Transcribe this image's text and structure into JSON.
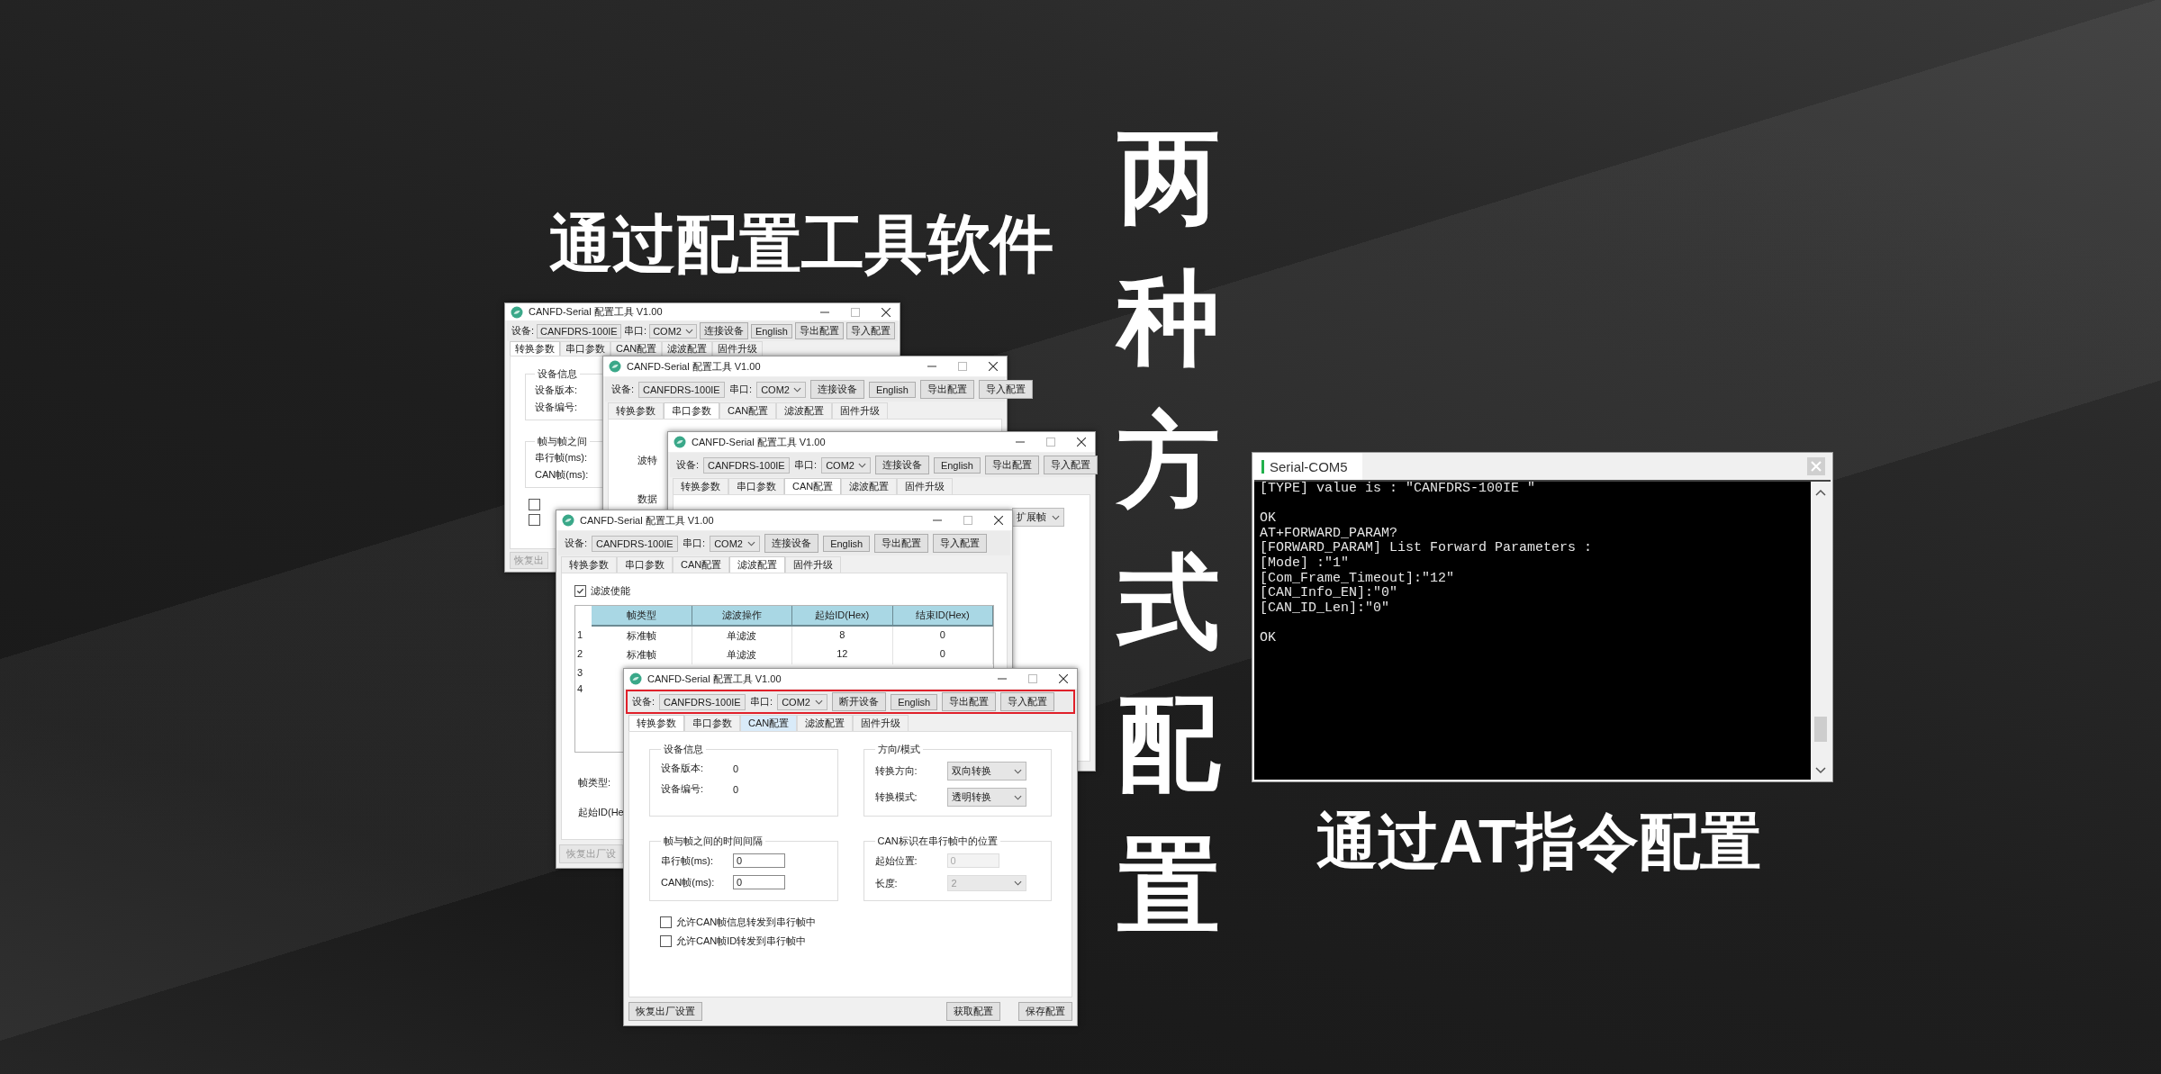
{
  "headline_left": "通过配置工具软件",
  "headline_center": "两种方式配置",
  "headline_right": "通过AT指令配置",
  "windows": [
    {
      "kind": "settings",
      "title": "CANFD-Serial 配置工具 V1.00",
      "toolbar": {
        "device_label": "设备:",
        "device": "CANFDRS-100IE",
        "port_label": "串口:",
        "port": "COM2",
        "buttons": [
          "连接设备",
          "English",
          "导出配置",
          "导入配置"
        ],
        "highlighted": false
      },
      "tabs": [
        {
          "label": "转换参数",
          "selected": true
        },
        {
          "label": "串口参数",
          "selected": false
        },
        {
          "label": "CAN配置",
          "selected": false
        },
        {
          "label": "滤波配置",
          "selected": false
        },
        {
          "label": "固件升级",
          "selected": false
        }
      ],
      "group_rows": [
        [
          {
            "title": "设备信息",
            "rows": [
              {
                "kind": "label",
                "label": "设备版本:"
              },
              {
                "kind": "label",
                "label": "设备编号:"
              }
            ]
          }
        ],
        [
          {
            "title": "帧与帧之间",
            "rows": [
              {
                "kind": "label",
                "label": "串行帧(ms):"
              },
              {
                "kind": "label",
                "label": "CAN帧(ms):"
              }
            ]
          }
        ]
      ],
      "checkboxes": [
        {
          "checked": false
        },
        {
          "checked": false
        }
      ],
      "footer_left": {
        "label": "恢复出",
        "disabled": true
      }
    },
    {
      "kind": "serial",
      "title": "CANFD-Serial 配置工具 V1.00",
      "toolbar": {
        "device_label": "设备:",
        "device": "CANFDRS-100IE",
        "port_label": "串口:",
        "port": "COM2",
        "buttons": [
          "连接设备",
          "English",
          "导出配置",
          "导入配置"
        ],
        "highlighted": false
      },
      "tabs": [
        {
          "label": "转换参数",
          "selected": false
        },
        {
          "label": "串口参数",
          "selected": true
        },
        {
          "label": "CAN配置",
          "selected": false
        },
        {
          "label": "滤波配置",
          "selected": false
        },
        {
          "label": "固件升级",
          "selected": false
        }
      ],
      "fields": [
        {
          "label": "波特"
        },
        {
          "label": "数据"
        }
      ]
    },
    {
      "kind": "can",
      "title": "CANFD-Serial 配置工具 V1.00",
      "toolbar": {
        "device_label": "设备:",
        "device": "CANFDRS-100IE",
        "port_label": "串口:",
        "port": "COM2",
        "buttons": [
          "连接设备",
          "English",
          "导出配置",
          "导入配置"
        ],
        "highlighted": false
      },
      "tabs": [
        {
          "label": "转换参数",
          "selected": false
        },
        {
          "label": "串口参数",
          "selected": false
        },
        {
          "label": "CAN配置",
          "selected": true
        },
        {
          "label": "滤波配置",
          "selected": false
        },
        {
          "label": "固件升级",
          "selected": false
        }
      ],
      "fields": [
        {
          "value": "扩展帧"
        }
      ]
    },
    {
      "kind": "filter",
      "title": "CANFD-Serial 配置工具 V1.00",
      "toolbar": {
        "device_label": "设备:",
        "device": "CANFDRS-100IE",
        "port_label": "串口:",
        "port": "COM2",
        "buttons": [
          "连接设备",
          "English",
          "导出配置",
          "导入配置"
        ],
        "highlighted": false
      },
      "tabs": [
        {
          "label": "转换参数",
          "selected": false
        },
        {
          "label": "串口参数",
          "selected": false
        },
        {
          "label": "CAN配置",
          "selected": false
        },
        {
          "label": "滤波配置",
          "selected": true
        },
        {
          "label": "固件升级",
          "selected": false
        }
      ],
      "enable": {
        "label": "滤波使能",
        "checked": true
      },
      "table": {
        "columns": [
          "帧类型",
          "滤波操作",
          "起始ID(Hex)",
          "结束ID(Hex)"
        ],
        "rows": [
          {
            "index": "1",
            "cells": [
              "标准帧",
              "单滤波",
              "8",
              "0"
            ]
          },
          {
            "index": "2",
            "cells": [
              "标准帧",
              "单滤波",
              "12",
              "0"
            ]
          },
          {
            "index": "3"
          },
          {
            "index": "4"
          }
        ]
      },
      "fields": [
        {
          "label": "帧类型:"
        },
        {
          "label": "起始ID(He"
        }
      ],
      "footer_left": {
        "label": "恢复出厂设",
        "disabled": true
      }
    },
    {
      "kind": "settings",
      "title": "CANFD-Serial 配置工具 V1.00",
      "toolbar": {
        "device_label": "设备:",
        "device": "CANFDRS-100IE",
        "port_label": "串口:",
        "port": "COM2",
        "buttons": [
          "断开设备",
          "English",
          "导出配置",
          "导入配置"
        ],
        "highlighted": true
      },
      "tabs": [
        {
          "label": "转换参数",
          "selected": true,
          "hovered": false
        },
        {
          "label": "串口参数",
          "selected": false,
          "hovered": false
        },
        {
          "label": "CAN配置",
          "selected": false,
          "hovered": true
        },
        {
          "label": "滤波配置",
          "selected": false,
          "hovered": false
        },
        {
          "label": "固件升级",
          "selected": false,
          "hovered": false
        }
      ],
      "group_rows": [
        [
          {
            "title": "设备信息",
            "rows": [
              {
                "kind": "text",
                "label": "设备版本:",
                "value": "0"
              },
              {
                "kind": "text",
                "label": "设备编号:",
                "value": "0"
              }
            ]
          },
          {
            "title": "方向/模式",
            "rows": [
              {
                "kind": "select",
                "label": "转换方向:",
                "value": "双向转换",
                "disabled": false
              },
              {
                "kind": "select",
                "label": "转换模式:",
                "value": "透明转换",
                "disabled": false
              }
            ]
          }
        ],
        [
          {
            "title": "帧与帧之间的时间间隔",
            "rows": [
              {
                "kind": "input",
                "label": "串行帧(ms):",
                "value": "0",
                "disabled": false
              },
              {
                "kind": "input",
                "label": "CAN帧(ms):",
                "value": "0",
                "disabled": false
              }
            ]
          },
          {
            "title": "CAN标识在串行帧中的位置",
            "rows": [
              {
                "kind": "input",
                "label": "起始位置:",
                "value": "0",
                "disabled": true
              },
              {
                "kind": "select",
                "label": "长度:",
                "value": "2",
                "disabled": true
              }
            ]
          }
        ]
      ],
      "checkboxes": [
        {
          "label": "允许CAN帧信息转发到串行帧中",
          "checked": false
        },
        {
          "label": "允许CAN帧ID转发到串行帧中",
          "checked": false
        }
      ],
      "footer_left": {
        "label": "恢复出厂设置",
        "disabled": false
      },
      "footer_right": [
        "获取配置",
        "保存配置"
      ]
    }
  ],
  "terminal": {
    "title": "Serial-COM5",
    "blocks": [
      [
        "[TYPE] value is : \"CANFDRS-100IE \""
      ],
      [
        "OK",
        "AT+FORWARD_PARAM?",
        "[FORWARD_PARAM] List Forward Parameters :",
        "[Mode] :\"1\"",
        "[Com_Frame_Timeout]:\"12\"",
        "[CAN_Info_EN]:\"0\"",
        "[CAN_ID_Len]:\"0\""
      ],
      [
        "OK"
      ]
    ]
  }
}
